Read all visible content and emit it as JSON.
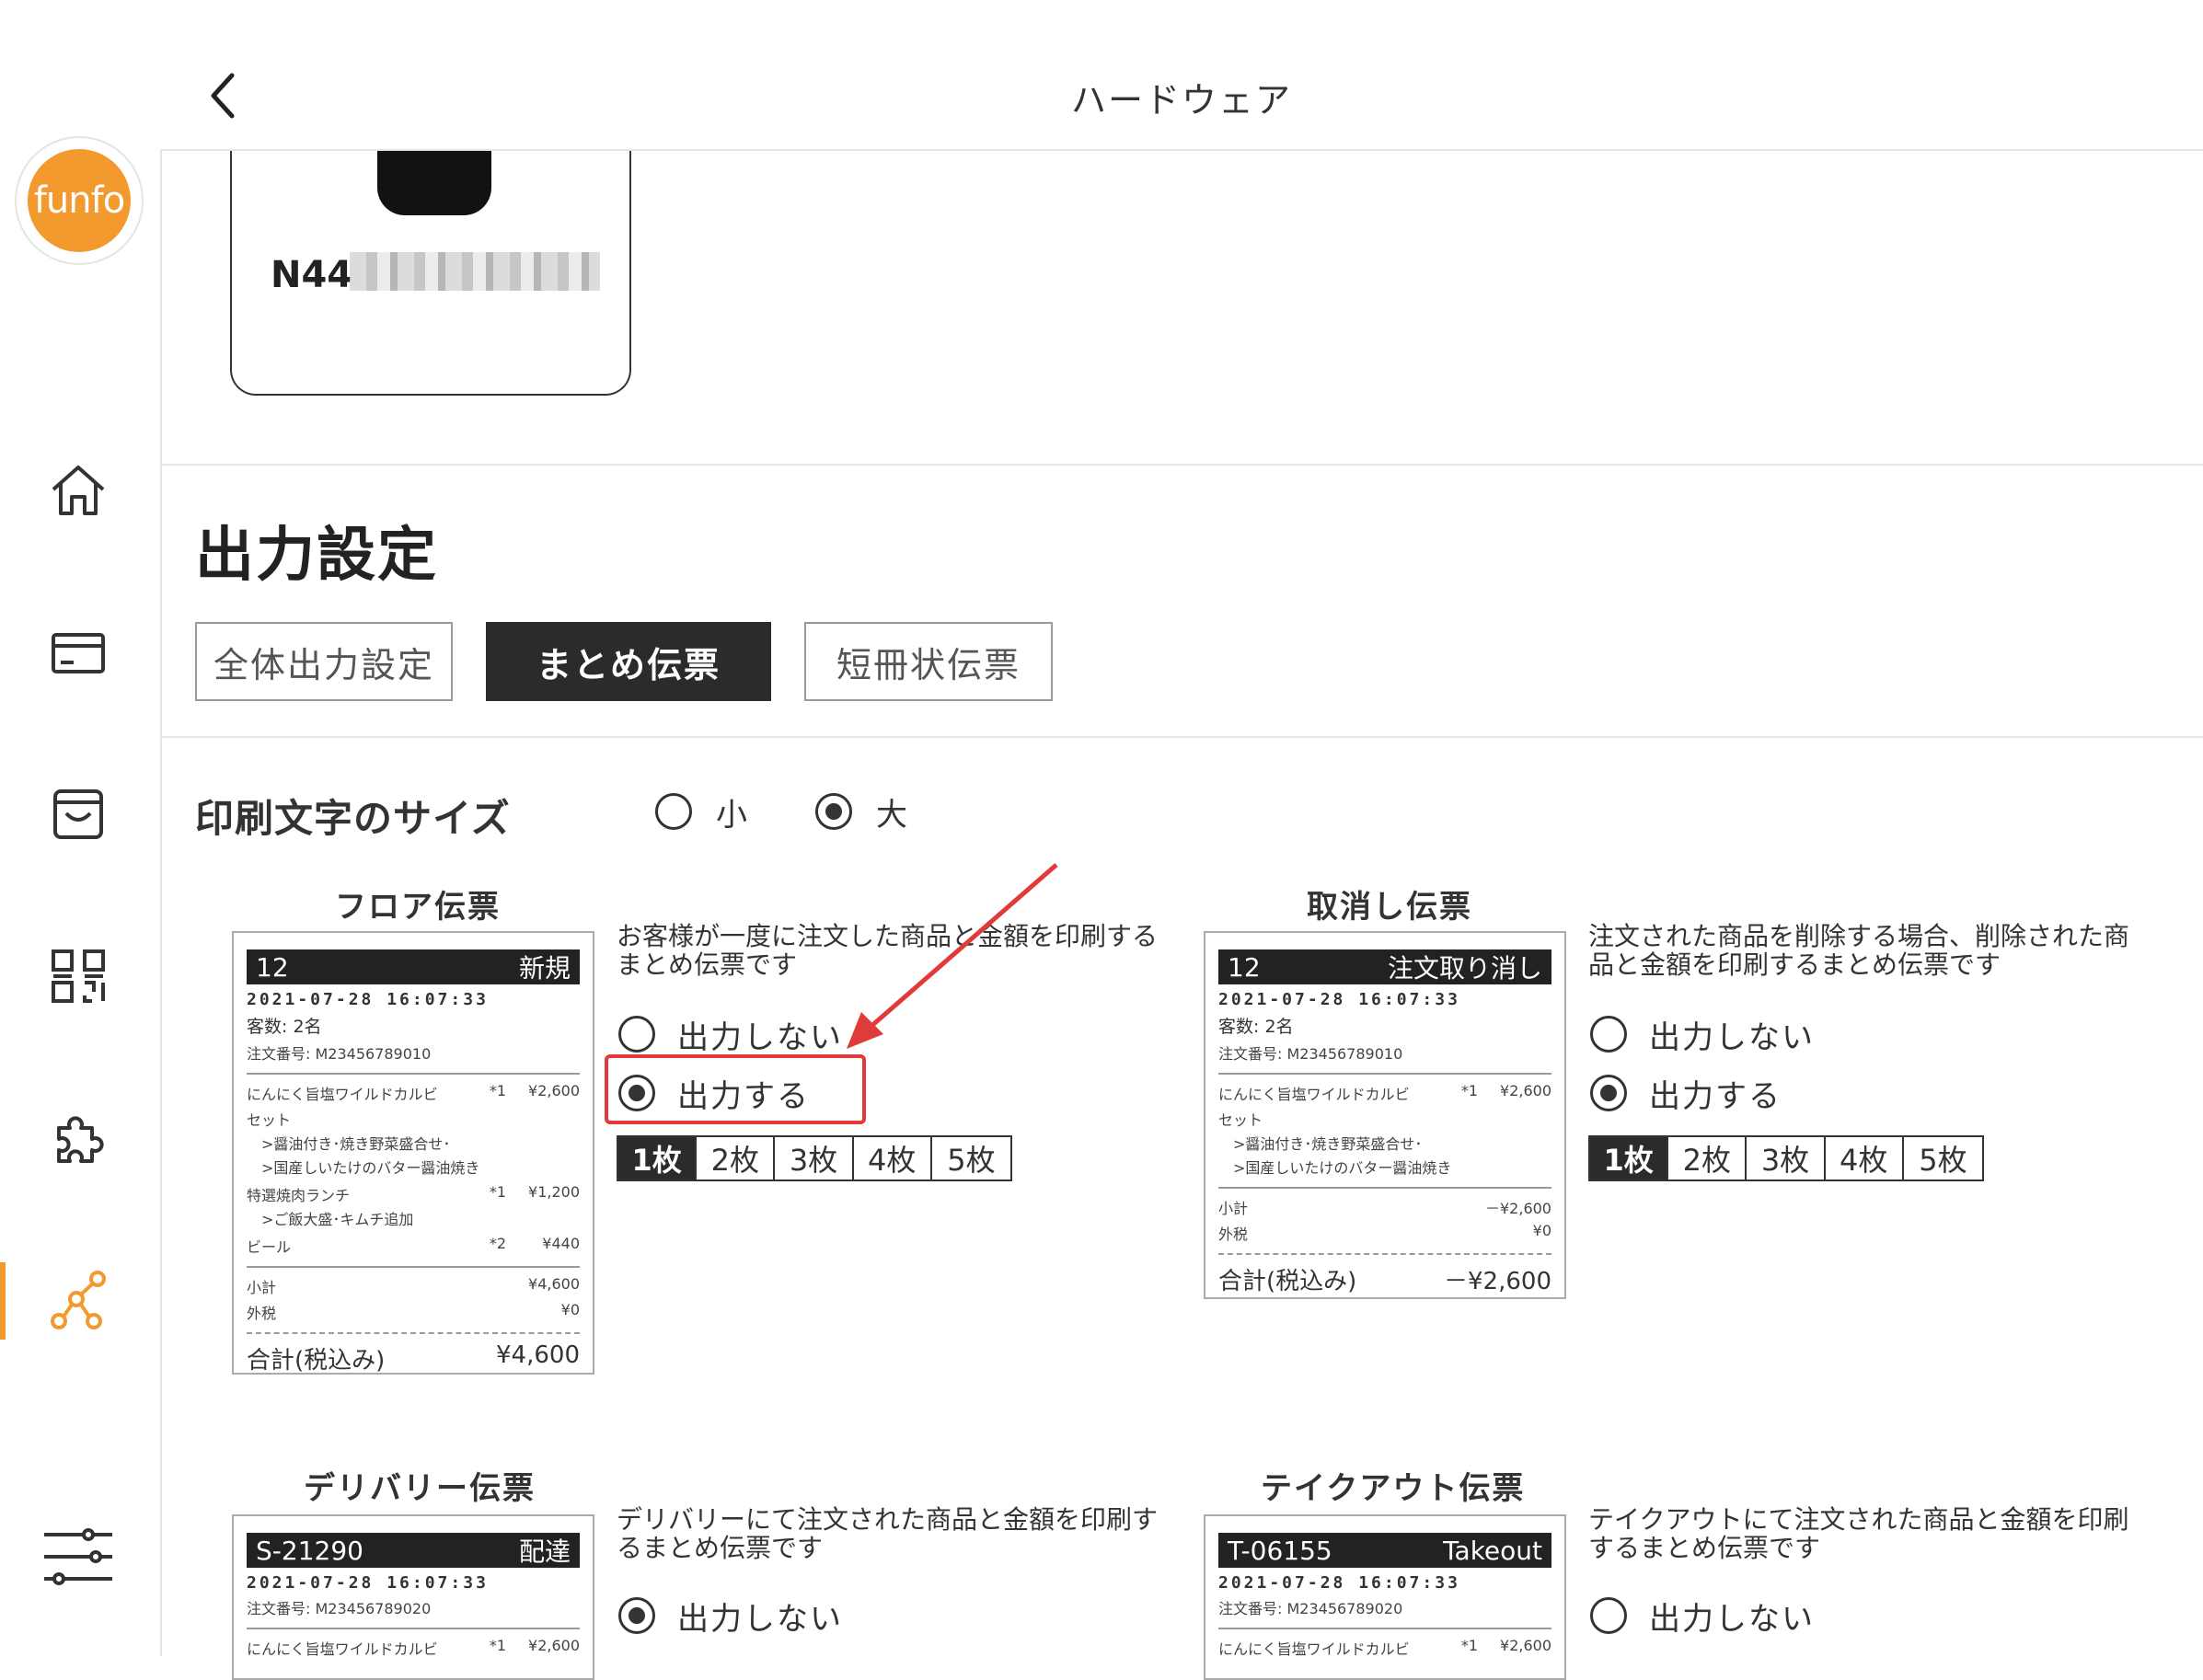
{
  "sidebar": {
    "logo_text": "funfo",
    "items": [
      {
        "icon": "home-icon"
      },
      {
        "icon": "card-icon"
      },
      {
        "icon": "box-icon"
      },
      {
        "icon": "qr-icon"
      },
      {
        "icon": "puzzle-icon"
      },
      {
        "icon": "network-icon",
        "active": true
      },
      {
        "icon": "sliders-icon"
      }
    ],
    "accent": "#f39a2e"
  },
  "header": {
    "title": "ハードウェア"
  },
  "device": {
    "name": "N44"
  },
  "section": {
    "title": "出力設定"
  },
  "tabs": [
    {
      "label": "全体出力設定",
      "active": false
    },
    {
      "label": "まとめ伝票",
      "active": true
    },
    {
      "label": "短冊状伝票",
      "active": false
    }
  ],
  "font_size": {
    "label": "印刷文字のサイズ",
    "options": [
      {
        "label": "小",
        "selected": false
      },
      {
        "label": "大",
        "selected": true
      }
    ]
  },
  "floor": {
    "title": "フロア伝票",
    "desc": "お客様が一度に注文した商品と金額を印刷するまとめ伝票です",
    "opt_off": "出力しない",
    "opt_on": "出力する",
    "selected": "on",
    "copies": [
      "1枚",
      "2枚",
      "3枚",
      "4枚",
      "5枚"
    ],
    "copies_selected": "1枚",
    "receipt": {
      "number": "12",
      "tag": "新規",
      "datetime": "2021-07-28 16:07:33",
      "guests": "客数: 2名",
      "order_no": "注文番号: M23456789010",
      "item1_name": "にんにく旨塩ワイルドカルビ",
      "item1_qty": "*1",
      "item1_price": "¥2,600",
      "item1_cont": "セット",
      "item1_sub1": ">醤油付き･焼き野菜盛合せ･",
      "item1_sub2": ">国産しいたけのバター醤油焼き",
      "item2_name": "特選焼肉ランチ",
      "item2_qty": "*1",
      "item2_price": "¥1,200",
      "item2_sub1": ">ご飯大盛･キムチ追加",
      "item3_name": "ビール",
      "item3_qty": "*2",
      "item3_price": "¥440",
      "subtotal_label": "小計",
      "subtotal": "¥4,600",
      "tax_label": "外税",
      "tax": "¥0",
      "total_label": "合計(税込み)",
      "total": "¥4,600"
    }
  },
  "cancel": {
    "title": "取消し伝票",
    "desc": "注文された商品を削除する場合、削除された商品と金額を印刷するまとめ伝票です",
    "opt_off": "出力しない",
    "opt_on": "出力する",
    "selected": "on",
    "copies": [
      "1枚",
      "2枚",
      "3枚",
      "4枚",
      "5枚"
    ],
    "copies_selected": "1枚",
    "receipt": {
      "number": "12",
      "tag": "注文取り消し",
      "datetime": "2021-07-28 16:07:33",
      "guests": "客数: 2名",
      "order_no": "注文番号: M23456789010",
      "item1_name": "にんにく旨塩ワイルドカルビ",
      "item1_qty": "*1",
      "item1_price": "¥2,600",
      "item1_cont": "セット",
      "item1_sub1": ">醤油付き･焼き野菜盛合せ･",
      "item1_sub2": ">国産しいたけのバター醤油焼き",
      "subtotal_label": "小計",
      "subtotal": "－¥2,600",
      "tax_label": "外税",
      "tax": "¥0",
      "total_label": "合計(税込み)",
      "total": "－¥2,600"
    }
  },
  "delivery": {
    "title": "デリバリー伝票",
    "desc": "デリバリーにて注文された商品と金額を印刷するまとめ伝票です",
    "opt_off": "出力しない",
    "selected": "off",
    "receipt": {
      "number": "S-21290",
      "tag": "配達",
      "datetime": "2021-07-28 16:07:33",
      "order_no": "注文番号: M23456789020",
      "item1_name": "にんにく旨塩ワイルドカルビ",
      "item1_qty": "*1",
      "item1_price": "¥2,600"
    }
  },
  "takeout": {
    "title": "テイクアウト伝票",
    "desc": "テイクアウトにて注文された商品と金額を印刷するまとめ伝票です",
    "opt_off": "出力しない",
    "selected": "none",
    "receipt": {
      "number": "T-06155",
      "tag": "Takeout",
      "datetime": "2021-07-28 16:07:33",
      "order_no": "注文番号: M23456789020",
      "item1_name": "にんにく旨塩ワイルドカルビ",
      "item1_qty": "*1",
      "item1_price": "¥2,600"
    }
  },
  "annotation_color": "#e03a3a"
}
